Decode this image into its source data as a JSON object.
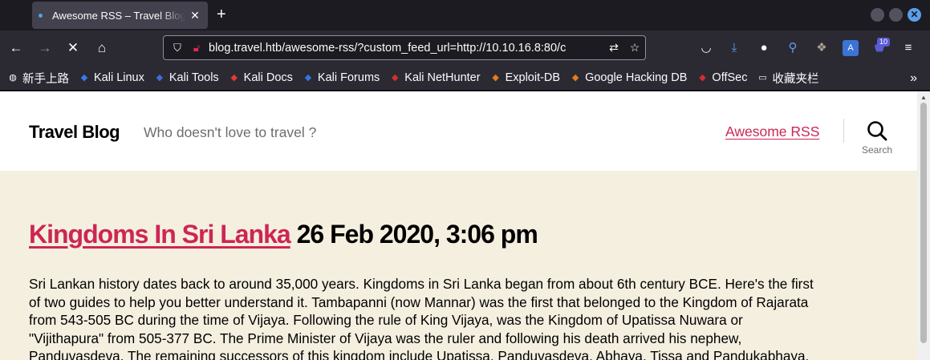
{
  "browser": {
    "tab": {
      "title": "Awesome RSS – Travel Blog"
    },
    "url": "blog.travel.htb/awesome-rss/?custom_feed_url=http://10.10.16.8:80/c",
    "extension_badge": "10",
    "bookmarks": [
      {
        "label": "新手上路",
        "icon": "globe-icon",
        "color": "#fbfbfe"
      },
      {
        "label": "Kali Linux",
        "icon": "kali-dragon-icon",
        "color": "#367bf0"
      },
      {
        "label": "Kali Tools",
        "icon": "kali-tools-icon",
        "color": "#3e6fd8"
      },
      {
        "label": "Kali Docs",
        "icon": "kali-docs-icon",
        "color": "#e53935"
      },
      {
        "label": "Kali Forums",
        "icon": "kali-forums-icon",
        "color": "#2f77e0"
      },
      {
        "label": "Kali NetHunter",
        "icon": "nethunter-icon",
        "color": "#d32f2f"
      },
      {
        "label": "Exploit-DB",
        "icon": "exploit-db-icon",
        "color": "#e57c20"
      },
      {
        "label": "Google Hacking DB",
        "icon": "ghdb-icon",
        "color": "#e57c20"
      },
      {
        "label": "OffSec",
        "icon": "offsec-icon",
        "color": "#d32f2f"
      },
      {
        "label": "收藏夹栏",
        "icon": "folder-icon",
        "color": "#fbfbfe"
      }
    ]
  },
  "site": {
    "title": "Travel Blog",
    "description": "Who doesn't love to travel ?",
    "menu": [
      "Awesome RSS"
    ],
    "search_label": "Search",
    "accent_color": "#cd2653",
    "background_color": "#f5efe0"
  },
  "post": {
    "title_link": "Kingdoms In Sri Lanka",
    "date": "26 Feb 2020, 3:06 pm",
    "content_lines": [
      "Sri Lankan history dates back to around 35,000 years. Kingdoms in Sri Lanka began from about 6th century BCE. Here's the first",
      "of two guides to help you better understand it. Tambapanni (now Mannar) was the first that belonged to the Kingdom of Rajarata",
      "from 543-505 BC during the time of Vijaya. Following the rule of King Vijaya, was the Kingdom of Upatissa Nuwara or",
      "\"Vijithapura\" from 505-377 BC. The Prime Minister of Vijaya was the ruler and following his death arrived his nephew,",
      "Panduvasdeva. The remaining successors of this kingdom include Upatissa, Panduvasdeva, Abhaya, Tissa and Pandukabhaya."
    ]
  }
}
